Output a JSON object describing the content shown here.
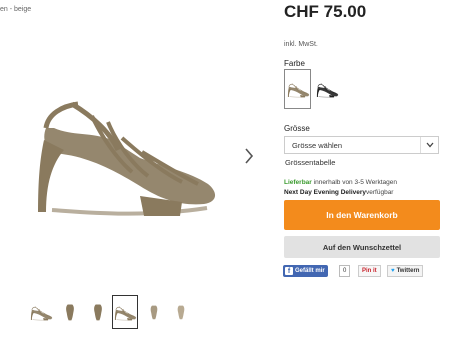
{
  "breadcrumb": "en - beige",
  "product": {
    "price": "CHF 75.00",
    "vat_note": "inkl. MwSt.",
    "color_label": "Farbe",
    "size_label": "Grösse",
    "size_select_value": "Grösse wählen",
    "size_table_link": "Grössentabelle",
    "availability": {
      "status": "Lieferbar",
      "delivery_time": "innerhalb von 3-5 Werktagen",
      "express_label": "Next Day Evening Delivery",
      "express_status": "verfügbar"
    }
  },
  "actions": {
    "cart_label": "In den Warenkorb",
    "wishlist_label": "Auf den Wunschzettel"
  },
  "social": {
    "facebook_label": "Gefällt mir",
    "facebook_count": "0",
    "pinterest_label": "Pin it",
    "twitter_label": "Twittern"
  },
  "colors": {
    "accent": "#f38b1c",
    "available_green": "#3a9a2e",
    "facebook_blue": "#4267b2",
    "pinterest_red": "#c8232c",
    "twitter_blue": "#1da1f2",
    "shoe_beige": "#8a7a5e",
    "shoe_black": "#222222"
  },
  "icons": {
    "next": "chevron-right-icon",
    "dropdown": "chevron-down-icon"
  }
}
